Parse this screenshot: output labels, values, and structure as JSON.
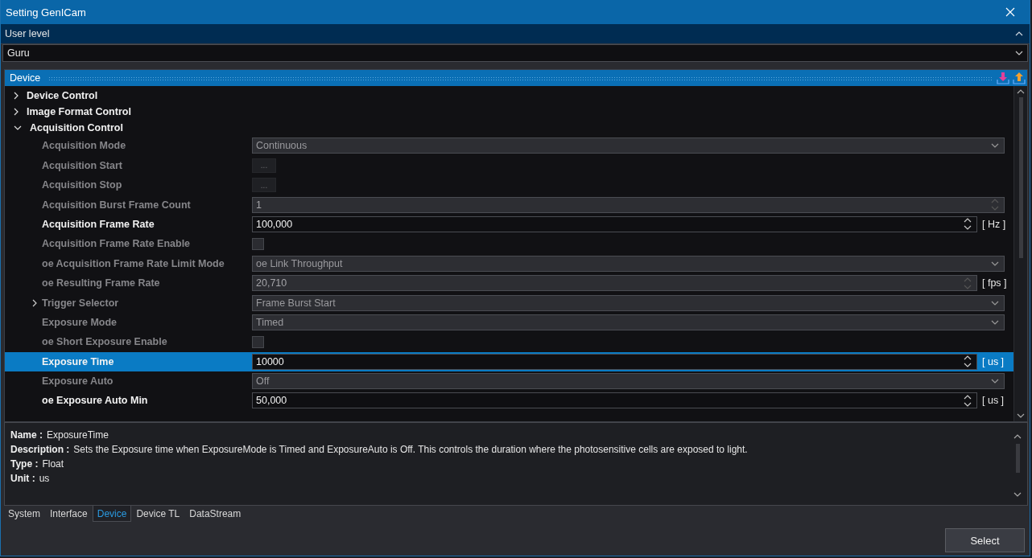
{
  "window": {
    "title": "Setting GenICam"
  },
  "user_level": {
    "label": "User level",
    "expanded": true,
    "value": "Guru"
  },
  "panel": {
    "title": "Device",
    "tree": [
      {
        "label": "Device Control",
        "expanded": false
      },
      {
        "label": "Image Format Control",
        "expanded": false
      },
      {
        "label": "Acquisition Control",
        "expanded": true,
        "children": [
          {
            "label": "Acquisition Mode",
            "kind": "combo",
            "disabled": true,
            "value": "Continuous",
            "selected": false
          },
          {
            "label": "Acquisition Start",
            "kind": "button",
            "disabled": true,
            "value": "...",
            "selected": false
          },
          {
            "label": "Acquisition Stop",
            "kind": "button",
            "disabled": true,
            "value": "...",
            "selected": false
          },
          {
            "label": "Acquisition Burst Frame Count",
            "kind": "spin",
            "disabled": true,
            "value": "1",
            "selected": false
          },
          {
            "label": "Acquisition Frame Rate",
            "kind": "spin",
            "disabled": false,
            "value": "100,000",
            "unit": "[ Hz ]",
            "selected": false
          },
          {
            "label": "Acquisition Frame Rate Enable",
            "kind": "check",
            "disabled": true,
            "checked": false,
            "selected": false
          },
          {
            "label": "oe Acquisition Frame Rate Limit Mode",
            "kind": "combo",
            "disabled": true,
            "value": "oe Link Throughput",
            "selected": false
          },
          {
            "label": "oe Resulting Frame Rate",
            "kind": "spin",
            "disabled": true,
            "value": "20,710",
            "unit": "[ fps ]",
            "selected": false
          },
          {
            "label": "Trigger Selector",
            "kind": "combo",
            "disabled": true,
            "expanded": false,
            "value": "Frame Burst Start",
            "selected": false
          },
          {
            "label": "Exposure Mode",
            "kind": "combo",
            "disabled": true,
            "value": "Timed",
            "selected": false
          },
          {
            "label": "oe Short Exposure Enable",
            "kind": "check",
            "disabled": true,
            "checked": false,
            "selected": false
          },
          {
            "label": "Exposure Time",
            "kind": "spin",
            "disabled": false,
            "value": "10000",
            "unit": "[ us ]",
            "selected": true
          },
          {
            "label": "Exposure Auto",
            "kind": "combo",
            "disabled": true,
            "value": "Off",
            "selected": false
          },
          {
            "label": "oe Exposure Auto Min",
            "kind": "spin",
            "disabled": false,
            "value": "50,000",
            "unit": "[ us ]",
            "selected": false
          }
        ]
      }
    ]
  },
  "info": [
    {
      "key": "Name :",
      "value": "ExposureTime"
    },
    {
      "key": "Description :",
      "value": "Sets the Exposure time when ExposureMode is Timed and ExposureAuto is Off. This controls the duration where the photosensitive cells are exposed to light."
    },
    {
      "key": "Type :",
      "value": "Float"
    },
    {
      "key": "Unit :",
      "value": "us"
    }
  ],
  "tabs": [
    {
      "label": "System",
      "selected": false
    },
    {
      "label": "Interface",
      "selected": false
    },
    {
      "label": "Device",
      "selected": true
    },
    {
      "label": "Device TL",
      "selected": false
    },
    {
      "label": "DataStream",
      "selected": false
    }
  ],
  "buttons": [
    "Select"
  ]
}
